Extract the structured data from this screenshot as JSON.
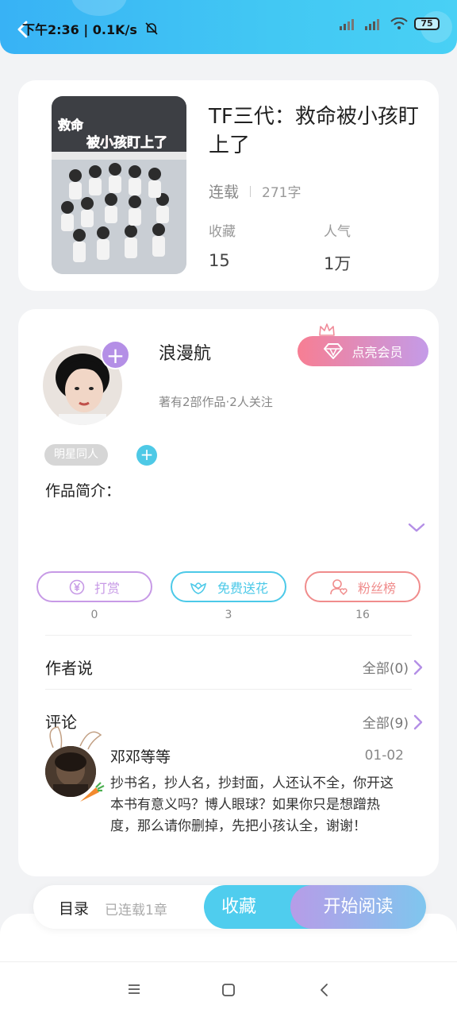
{
  "status_bar": {
    "time": "下午2:36",
    "speed": "0.1K/s",
    "battery": "75"
  },
  "book": {
    "title": "TF三代：救命被小孩盯上了",
    "status": "连载",
    "word_count": "271字",
    "stats": [
      {
        "label": "收藏",
        "value": "15"
      },
      {
        "label": "人气",
        "value": "1万"
      }
    ],
    "cover_text": [
      "救命",
      "被小孩盯上了"
    ]
  },
  "author": {
    "name": "浪漫航",
    "subtitle": "著有2部作品·2人关注",
    "vip_button": "点亮会员",
    "follow_symbol": "+"
  },
  "tags": {
    "items": [
      "明星同人"
    ],
    "add_symbol": "+"
  },
  "intro": {
    "label": "作品简介："
  },
  "actions": [
    {
      "label": "打赏",
      "count": "0",
      "color": "#c79ae6"
    },
    {
      "label": "免费送花",
      "count": "3",
      "color": "#4cc9e8"
    },
    {
      "label": "粉丝榜",
      "count": "16",
      "color": "#f08c8c"
    }
  ],
  "author_says": {
    "title": "作者说",
    "all": "全部(0)"
  },
  "comments": {
    "title": "评论",
    "all": "全部(9)",
    "items": [
      {
        "user": "邓邓等等",
        "date": "01-02",
        "text": "抄书名，抄人名，抄封面，人还认不全，你开这本书有意义吗？博人眼球？如果你只是想蹭热度，那么请你删掉，先把小孩认全，谢谢！"
      }
    ]
  },
  "bottom_bar": {
    "toc": "目录",
    "toc_status": "已连载1章",
    "collect": "收藏",
    "read": "开始阅读"
  },
  "colors": {
    "accent_blue": "#4fcdee",
    "accent_purple": "#b48fe6",
    "vip_pink": "#f77e93"
  },
  "icons": [
    "back-icon",
    "mute-icon",
    "signal-icon",
    "wifi-icon",
    "battery-icon",
    "diamond-icon",
    "crown-icon",
    "chevron-down-icon",
    "yen-icon",
    "flower-icon",
    "fan-rank-icon",
    "chevron-right-icon",
    "menu-icon",
    "home-icon",
    "back-nav-icon"
  ]
}
